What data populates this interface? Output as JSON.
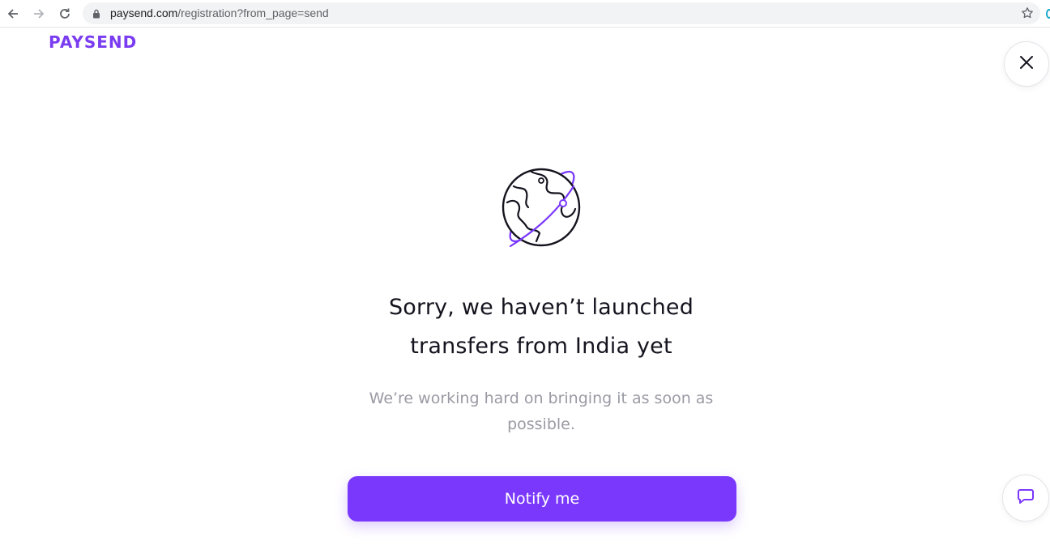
{
  "browser": {
    "url_host": "paysend.com",
    "url_path": "/registration?from_page=send",
    "icons": [
      "back-arrow-icon",
      "forward-arrow-icon",
      "reload-icon",
      "lock-icon",
      "star-icon"
    ]
  },
  "header": {
    "logo_text": "PAYSEND",
    "close_icon": "close-icon"
  },
  "main": {
    "illustration": "globe-orbit-icon",
    "title_line1": "Sorry, we haven’t launched",
    "title_line2": "transfers from India yet",
    "subtitle": "We’re working hard on bringing it as soon as possible.",
    "notify_label": "Notify me"
  },
  "chat": {
    "icon": "chat-bubble-icon"
  },
  "colors": {
    "brand": "#7a38fc",
    "logo": "#7a3cf0",
    "title": "#15131e",
    "subtitle": "#9a9aa4"
  }
}
